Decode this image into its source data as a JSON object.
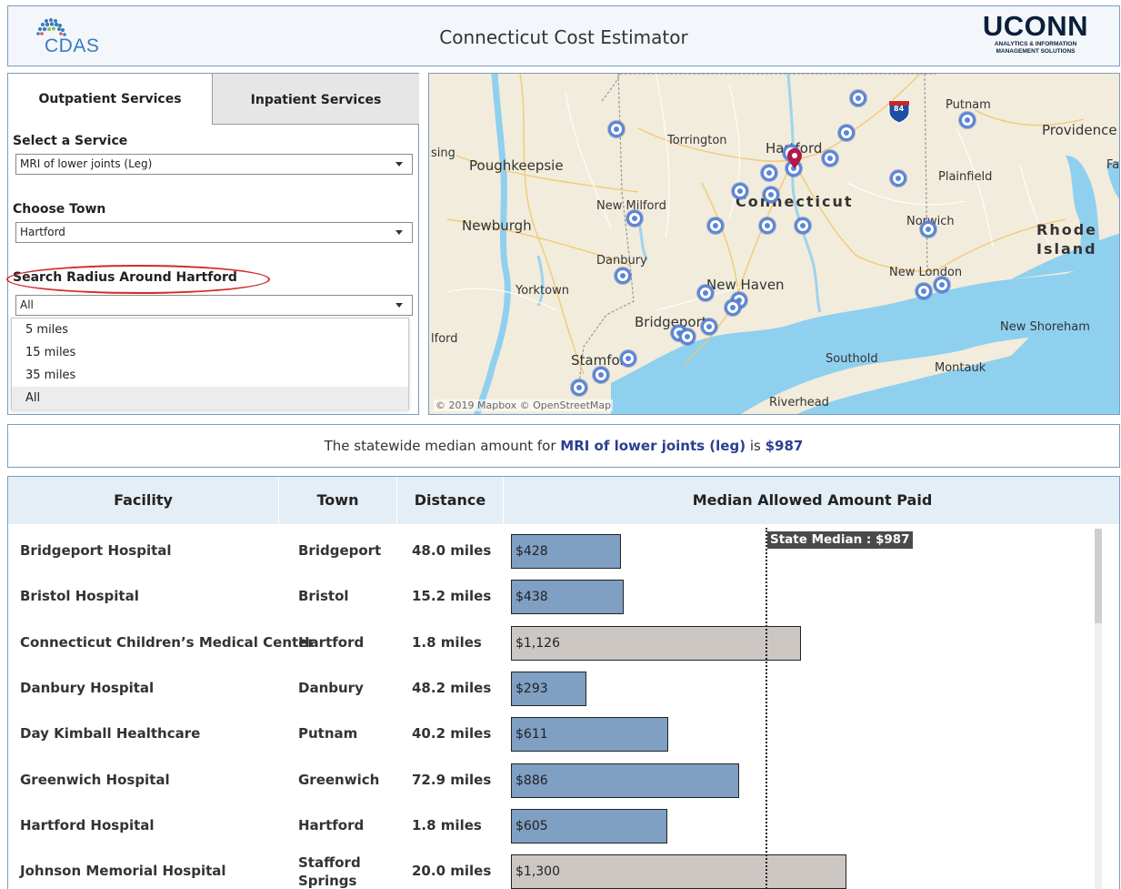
{
  "header": {
    "logo_left_text": "CDAS",
    "title": "Connecticut Cost Estimator",
    "logo_right_main": "UCONN",
    "logo_right_sub_1": "ANALYTICS & INFORMATION",
    "logo_right_sub_2": "MANAGEMENT SOLUTIONS"
  },
  "tabs": {
    "outpatient": "Outpatient Services",
    "inpatient": "Inpatient Services"
  },
  "controls": {
    "service_label": "Select a Service",
    "service_value": "MRI of lower joints (Leg)",
    "town_label": "Choose Town",
    "town_value": "Hartford",
    "radius_label": "Search Radius Around Hartford",
    "radius_value": "All",
    "radius_options": [
      "5 miles",
      "15 miles",
      "35 miles",
      "All"
    ]
  },
  "map": {
    "labels": {
      "poughkeepsie": "Poughkeepsie",
      "sing": "sing",
      "torrington": "Torrington",
      "hartford": "Hartford",
      "putnam": "Putnam",
      "providence": "Providence",
      "fa": "Fa",
      "plainfield": "Plainfield",
      "new_milford": "New Milford",
      "connecticut": "Connecticut",
      "newburgh": "Newburgh",
      "norwich": "Norwich",
      "rhode": "Rhode",
      "island": "Island",
      "danbury": "Danbury",
      "new_london": "New London",
      "yorktown": "Yorktown",
      "new_haven": "New Haven",
      "bridgeport": "Bridgeport",
      "new_shoreham": "New Shoreham",
      "ilford": "lford",
      "stamford": "Stamford",
      "southold": "Southold",
      "montauk": "Montauk",
      "riverhead": "Riverhead",
      "shield": "84"
    },
    "credit": "© 2019 Mapbox © OpenStreetMap"
  },
  "banner": {
    "prefix": "The statewide median amount for ",
    "service": "MRI of lower joints (leg)",
    "middle": " is ",
    "amount": "$987"
  },
  "table": {
    "headers": [
      "Facility",
      "Town",
      "Distance",
      "Median Allowed Amount Paid"
    ],
    "state_median_label": "State Median : $987",
    "state_median": 987,
    "rows": [
      {
        "facility": "Bridgeport Hospital",
        "town": "Bridgeport",
        "town2": "",
        "distance": "48.0 miles",
        "amount": 428,
        "label": "$428"
      },
      {
        "facility": "Bristol Hospital",
        "town": "Bristol",
        "town2": "",
        "distance": "15.2 miles",
        "amount": 438,
        "label": "$438"
      },
      {
        "facility": "Connecticut Children’s Medical Center",
        "town": "Hartford",
        "town2": "",
        "distance": "1.8 miles",
        "amount": 1126,
        "label": "$1,126"
      },
      {
        "facility": "Danbury Hospital",
        "town": "Danbury",
        "town2": "",
        "distance": "48.2 miles",
        "amount": 293,
        "label": "$293"
      },
      {
        "facility": "Day Kimball Healthcare",
        "town": "Putnam",
        "town2": "",
        "distance": "40.2 miles",
        "amount": 611,
        "label": "$611"
      },
      {
        "facility": "Greenwich Hospital",
        "town": "Greenwich",
        "town2": "",
        "distance": "72.9 miles",
        "amount": 886,
        "label": "$886"
      },
      {
        "facility": "Hartford Hospital",
        "town": "Hartford",
        "town2": "",
        "distance": "1.8 miles",
        "amount": 605,
        "label": "$605"
      },
      {
        "facility": "Johnson Memorial Hospital",
        "town": "Stafford",
        "town2": "Springs",
        "distance": "20.0 miles",
        "amount": 1300,
        "label": "$1,300"
      }
    ]
  },
  "colors": {
    "below_median": "#7f9fc3",
    "above_median": "#cdc7c4",
    "accent_text": "#2c3e8f",
    "border": "#7a9cc0"
  }
}
